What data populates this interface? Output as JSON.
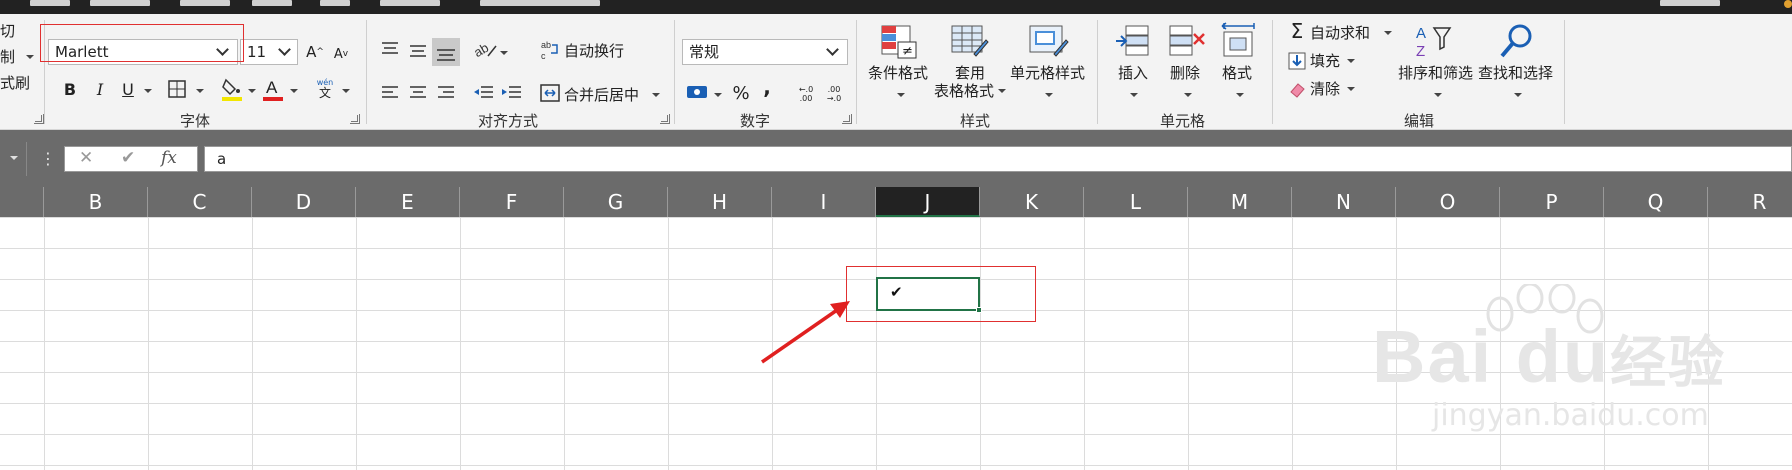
{
  "clipboard": {
    "cut_label": "切",
    "copy_label": "制",
    "format_painter_label": "式刷"
  },
  "font": {
    "name_value": "Marlett",
    "size_value": "11",
    "bold": "B",
    "italic": "I",
    "underline": "U",
    "phonetic_top": "wén",
    "phonetic_bottom": "文",
    "group_label": "字体"
  },
  "alignment": {
    "wrap_text_label": "自动换行",
    "merge_center_label": "合并后居中",
    "group_label": "对齐方式"
  },
  "number": {
    "format_value": "常规",
    "percent": "%",
    "comma": ",",
    "inc_decimal": "←.0 .00",
    "dec_decimal": ".00 →.0",
    "group_label": "数字"
  },
  "styles": {
    "conditional_label": "条件格式",
    "table_label_1": "套用",
    "table_label_2": "表格格式",
    "cell_styles_label": "单元格样式",
    "group_label": "样式"
  },
  "cells": {
    "insert_label": "插入",
    "delete_label": "删除",
    "format_label": "格式",
    "group_label": "单元格"
  },
  "editing": {
    "autosum_label": "自动求和",
    "fill_label": "填充",
    "clear_label": "清除",
    "sort_filter_label": "排序和筛选",
    "find_select_label": "查找和选择",
    "group_label": "编辑"
  },
  "formula_bar": {
    "cancel": "✕",
    "enter": "✔",
    "fx": "fx",
    "content": "a"
  },
  "columns": [
    "B",
    "C",
    "D",
    "E",
    "F",
    "G",
    "H",
    "I",
    "J",
    "K",
    "L",
    "M",
    "N",
    "O",
    "P",
    "Q",
    "R"
  ],
  "active_column": "J",
  "active_cell": {
    "display": "✔"
  },
  "watermark": {
    "brand": "Bai  du",
    "brand_cn": "经验",
    "url": "jingyan.baidu.com"
  },
  "colors": {
    "accent_red": "#e03030",
    "excel_green": "#217346",
    "header_gray": "#6b6b6b"
  }
}
